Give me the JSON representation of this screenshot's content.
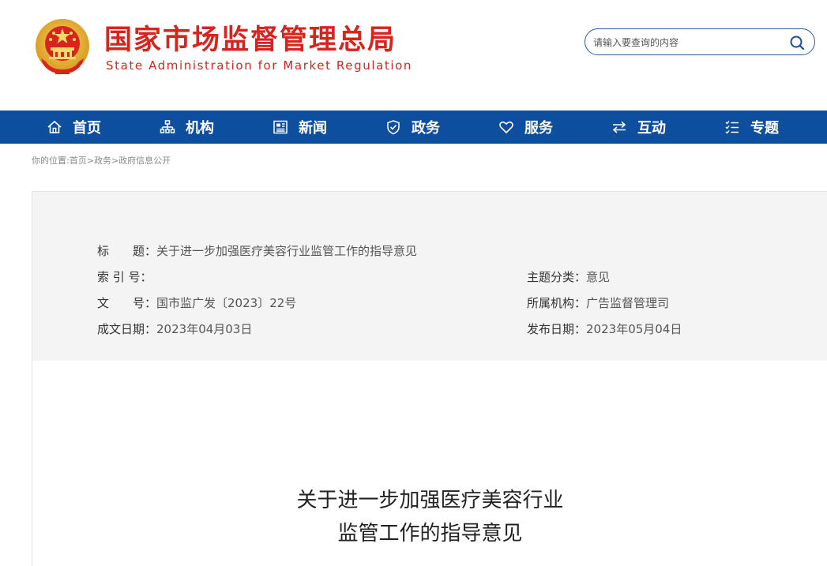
{
  "header": {
    "title": "国家市场监督管理总局",
    "subtitle": "State Administration for Market Regulation",
    "emblem_icon": "national-emblem-icon",
    "search_placeholder": "请输入要查询的内容",
    "search_icon": "search-icon"
  },
  "colors": {
    "brand_red": "#d8241c",
    "nav_blue": "#0e4e9e",
    "panel_bg": "#f4f4f4"
  },
  "nav": {
    "items": [
      {
        "label": "首页",
        "icon": "home-icon"
      },
      {
        "label": "机构",
        "icon": "org-chart-icon"
      },
      {
        "label": "新闻",
        "icon": "news-icon"
      },
      {
        "label": "政务",
        "icon": "shield-icon"
      },
      {
        "label": "服务",
        "icon": "heart-icon"
      },
      {
        "label": "互动",
        "icon": "exchange-arrows-icon"
      },
      {
        "label": "专题",
        "icon": "list-icon"
      }
    ]
  },
  "breadcrumb": {
    "prefix": "你的位置:",
    "items": [
      "首页",
      "政务",
      "政府信息公开"
    ],
    "separator": ">"
  },
  "info": {
    "title_label": "标　　题：",
    "title_value": "关于进一步加强医疗美容行业监管工作的指导意见",
    "index_label": "索 引 号：",
    "index_value": "",
    "category_label": "主题分类：",
    "category_value": "意见",
    "doc_no_label": "文　　号：",
    "doc_no_value": "国市监广发〔2023〕22号",
    "agency_label": "所属机构：",
    "agency_value": "广告监督管理司",
    "written_label": "成文日期：",
    "written_value": "2023年04月03日",
    "published_label": "发布日期：",
    "published_value": "2023年05月04日"
  },
  "article": {
    "title_line1": "关于进一步加强医疗美容行业",
    "title_line2": "监管工作的指导意见"
  }
}
